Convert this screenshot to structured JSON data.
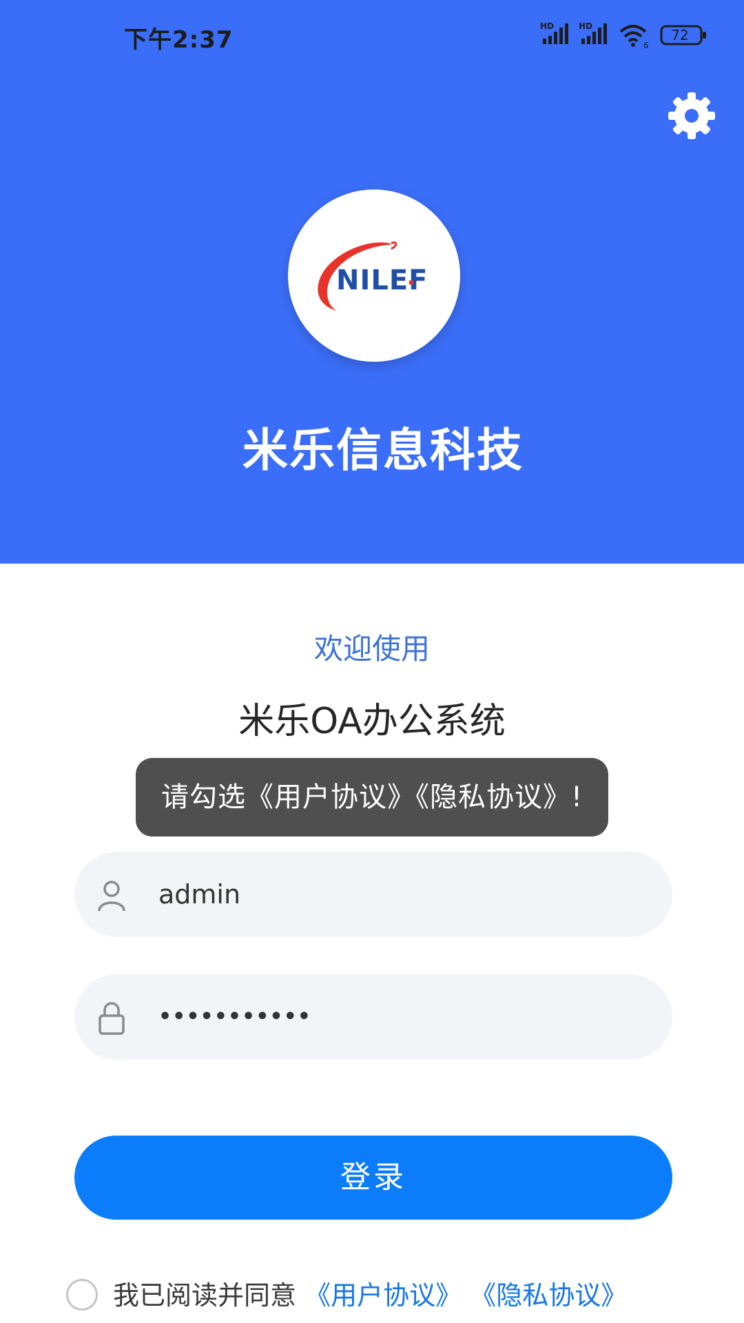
{
  "status_bar": {
    "time": "下午2:37",
    "battery": "72",
    "network_labels": [
      "HD",
      "HD"
    ],
    "wifi_label": "6"
  },
  "header": {
    "brand_title": "米乐信息科技",
    "logo_text": "NILEF",
    "background_color": "#3b6ef8"
  },
  "welcome_text": "欢迎使用",
  "system_title": "米乐OA办公系统",
  "toast_message": "请勾选《用户协议》《隐私协议》!",
  "form": {
    "username_value": "admin",
    "password_mask": "•••••••••••"
  },
  "login_button_label": "登录",
  "agreement": {
    "prefix": "我已阅读并同意",
    "user_agreement": "《用户协议》",
    "privacy_agreement": "《隐私协议》"
  },
  "colors": {
    "accent": "#0b7dfa",
    "link": "#1677e6",
    "welcome": "#3e73d6"
  }
}
